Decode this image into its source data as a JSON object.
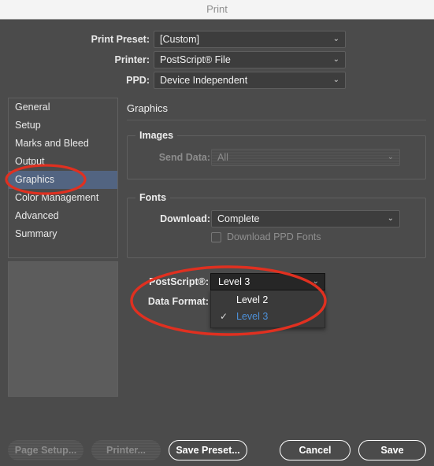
{
  "window": {
    "title": "Print"
  },
  "header": {
    "rows": [
      {
        "label": "Print Preset:",
        "value": "[Custom]"
      },
      {
        "label": "Printer:",
        "value": "PostScript® File"
      },
      {
        "label": "PPD:",
        "value": "Device Independent"
      }
    ]
  },
  "sidebar": {
    "items": [
      {
        "label": "General",
        "selected": false
      },
      {
        "label": "Setup",
        "selected": false
      },
      {
        "label": "Marks and Bleed",
        "selected": false
      },
      {
        "label": "Output",
        "selected": false
      },
      {
        "label": "Graphics",
        "selected": true
      },
      {
        "label": "Color Management",
        "selected": false
      },
      {
        "label": "Advanced",
        "selected": false
      },
      {
        "label": "Summary",
        "selected": false
      }
    ]
  },
  "main": {
    "title": "Graphics",
    "images_group": {
      "label": "Images",
      "send_data_label": "Send Data:",
      "send_data_value": "All"
    },
    "fonts_group": {
      "label": "Fonts",
      "download_label": "Download:",
      "download_value": "Complete",
      "ppd_fonts_label": "Download PPD Fonts"
    },
    "postscript_label": "PostScript®:",
    "postscript_value": "Level 3",
    "data_format_label": "Data Format:",
    "dropdown": {
      "options": [
        {
          "label": "Level 2",
          "checked": false
        },
        {
          "label": "Level 3",
          "checked": true
        }
      ],
      "check_glyph": "✓"
    }
  },
  "footer": {
    "buttons": [
      {
        "label": "Page Setup...",
        "enabled": false
      },
      {
        "label": "Printer...",
        "enabled": false
      },
      {
        "label": "Save Preset...",
        "enabled": true
      },
      {
        "label": "Cancel",
        "enabled": true
      },
      {
        "label": "Save",
        "enabled": true
      }
    ]
  },
  "icons": {
    "chevron_down": "⌄"
  },
  "colors": {
    "accent_selection": "#526481",
    "annotation_red": "#e03020",
    "menu_checked_text": "#4d90d8"
  }
}
